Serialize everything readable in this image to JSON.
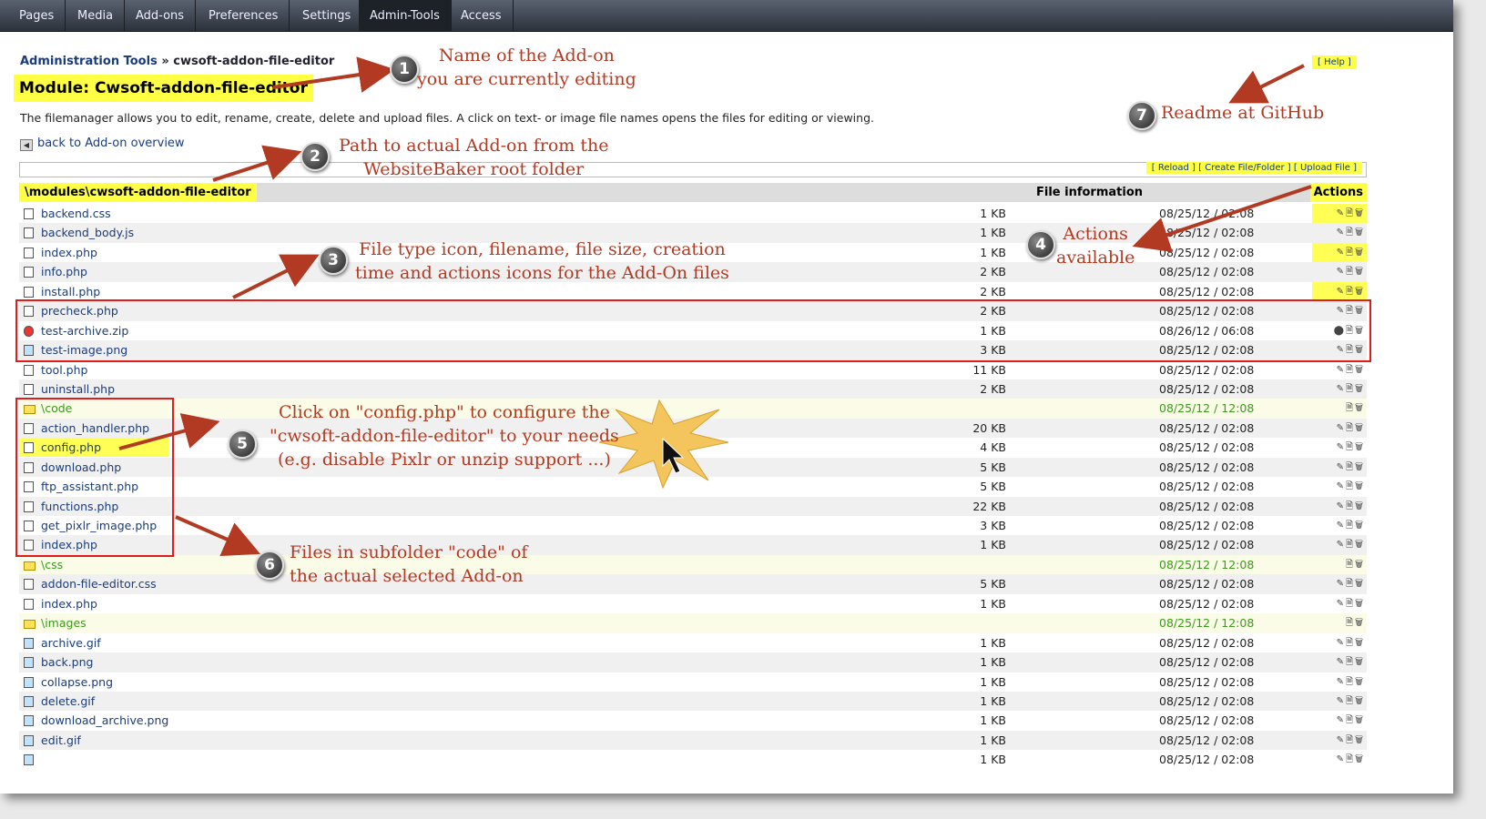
{
  "nav": {
    "items": [
      "Pages",
      "Media",
      "Add-ons",
      "Preferences",
      "Settings",
      "Admin-Tools",
      "Access"
    ],
    "active": "Admin-Tools"
  },
  "breadcrumb": {
    "link": "Administration Tools",
    "sep": " » ",
    "current": "cwsoft-addon-file-editor"
  },
  "module_title": "Module: Cwsoft-addon-file-editor",
  "help_label": "[ Help ]",
  "intro": "The filemanager allows you to edit, rename, create, delete and upload files. A click on text- or image file names opens the files for editing or viewing.",
  "back_label": "back to Add-on overview",
  "top_actions": "[ Reload ]  [ Create File/Folder ]  [ Upload File ]",
  "table": {
    "path": "\\modules\\cwsoft-addon-file-editor",
    "col_info": "File information",
    "col_actions": "Actions",
    "rows": [
      {
        "icon": "file",
        "name": "backend.css",
        "size": "1 KB",
        "date": "08/25/12 / 02:08",
        "acts": "✎🗎🗑"
      },
      {
        "icon": "file",
        "name": "backend_body.js",
        "size": "1 KB",
        "date": "08/25/12 / 02:08",
        "acts": "✎🗎🗑"
      },
      {
        "icon": "file",
        "name": "index.php",
        "size": "1 KB",
        "date": "08/25/12 / 02:08",
        "acts": "✎🗎🗑"
      },
      {
        "icon": "file",
        "name": "info.php",
        "size": "2 KB",
        "date": "08/25/12 / 02:08",
        "acts": "✎🗎🗑"
      },
      {
        "icon": "file",
        "name": "install.php",
        "size": "2 KB",
        "date": "08/25/12 / 02:08",
        "acts": "✎🗎🗑"
      },
      {
        "icon": "file",
        "name": "precheck.php",
        "size": "2 KB",
        "date": "08/25/12 / 02:08",
        "acts": "✎🗎🗑"
      },
      {
        "icon": "zip",
        "name": "test-archive.zip",
        "size": "1 KB",
        "date": "08/26/12 / 06:08",
        "acts": "⬤🗎🗑"
      },
      {
        "icon": "img",
        "name": "test-image.png",
        "size": "3 KB",
        "date": "08/25/12 / 02:08",
        "acts": "✎🗎🗑"
      },
      {
        "icon": "file",
        "name": "tool.php",
        "size": "11 KB",
        "date": "08/25/12 / 02:08",
        "acts": "✎🗎🗑"
      },
      {
        "icon": "file",
        "name": "uninstall.php",
        "size": "2 KB",
        "date": "08/25/12 / 02:08",
        "acts": "✎🗎🗑"
      },
      {
        "icon": "folder",
        "name": "\\code",
        "size": "",
        "date": "08/25/12 / 12:08",
        "acts": "🗎🗑"
      },
      {
        "icon": "file",
        "name": "action_handler.php",
        "size": "20 KB",
        "date": "08/25/12 / 02:08",
        "acts": "✎🗎🗑"
      },
      {
        "icon": "file",
        "name": "config.php",
        "size": "4 KB",
        "date": "08/25/12 / 02:08",
        "acts": "✎🗎🗑"
      },
      {
        "icon": "file",
        "name": "download.php",
        "size": "5 KB",
        "date": "08/25/12 / 02:08",
        "acts": "✎🗎🗑"
      },
      {
        "icon": "file",
        "name": "ftp_assistant.php",
        "size": "5 KB",
        "date": "08/25/12 / 02:08",
        "acts": "✎🗎🗑"
      },
      {
        "icon": "file",
        "name": "functions.php",
        "size": "22 KB",
        "date": "08/25/12 / 02:08",
        "acts": "✎🗎🗑"
      },
      {
        "icon": "file",
        "name": "get_pixlr_image.php",
        "size": "3 KB",
        "date": "08/25/12 / 02:08",
        "acts": "✎🗎🗑"
      },
      {
        "icon": "file",
        "name": "index.php",
        "size": "1 KB",
        "date": "08/25/12 / 02:08",
        "acts": "✎🗎🗑"
      },
      {
        "icon": "folder",
        "name": "\\css",
        "size": "",
        "date": "08/25/12 / 12:08",
        "acts": "🗎🗑"
      },
      {
        "icon": "file",
        "name": "addon-file-editor.css",
        "size": "5 KB",
        "date": "08/25/12 / 02:08",
        "acts": "✎🗎🗑"
      },
      {
        "icon": "file",
        "name": "index.php",
        "size": "1 KB",
        "date": "08/25/12 / 02:08",
        "acts": "✎🗎🗑"
      },
      {
        "icon": "folder",
        "name": "\\images",
        "size": "",
        "date": "08/25/12 / 12:08",
        "acts": "🗎🗑"
      },
      {
        "icon": "img",
        "name": "archive.gif",
        "size": "1 KB",
        "date": "08/25/12 / 02:08",
        "acts": "✎🗎🗑"
      },
      {
        "icon": "img",
        "name": "back.png",
        "size": "1 KB",
        "date": "08/25/12 / 02:08",
        "acts": "✎🗎🗑"
      },
      {
        "icon": "img",
        "name": "collapse.png",
        "size": "1 KB",
        "date": "08/25/12 / 02:08",
        "acts": "✎🗎🗑"
      },
      {
        "icon": "img",
        "name": "delete.gif",
        "size": "1 KB",
        "date": "08/25/12 / 02:08",
        "acts": "✎🗎🗑"
      },
      {
        "icon": "img",
        "name": "download_archive.png",
        "size": "1 KB",
        "date": "08/25/12 / 02:08",
        "acts": "✎🗎🗑"
      },
      {
        "icon": "img",
        "name": "edit.gif",
        "size": "1 KB",
        "date": "08/25/12 / 02:08",
        "acts": "✎🗎🗑"
      },
      {
        "icon": "img",
        "name": "",
        "size": "1 KB",
        "date": "08/25/12 / 02:08",
        "acts": "✎🗎🗑"
      }
    ]
  },
  "annotations": {
    "a1": "Name of the Add-on\nyou are currently editing",
    "a2": "Path to actual Add-on from the\nWebsiteBaker root folder",
    "a3": "File type icon, filename, file size, creation\ntime and actions icons for the Add-On files",
    "a4": "Actions\navailable",
    "a5": "Click on \"config.php\" to configure the\n\"cwsoft-addon-file-editor\" to your needs\n(e.g. disable Pixlr or unzip support ...)",
    "a6": "Files in subfolder \"code\" of\nthe actual selected Add-on",
    "a7": "Readme at GitHub"
  },
  "badges": [
    "1",
    "2",
    "3",
    "4",
    "5",
    "6",
    "7"
  ],
  "colors": {
    "annotation": "#b23a22",
    "highlight": "#ffff44",
    "redbox": "#e21b1b",
    "link": "#1b3c7a",
    "folder": "#3a9a1a"
  }
}
